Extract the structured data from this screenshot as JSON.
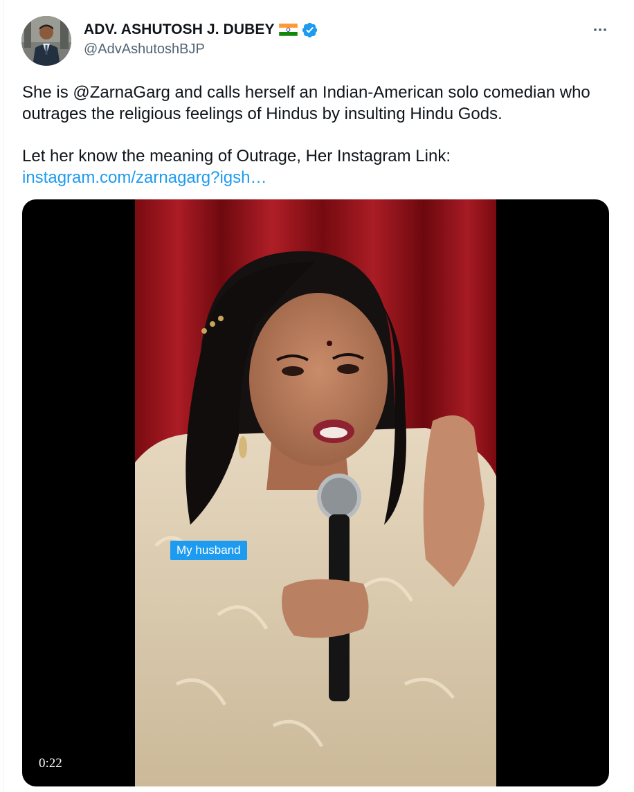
{
  "author": {
    "name": "ADV. ASHUTOSH J. DUBEY",
    "flag_icon": "india-flag-icon",
    "verified_icon": "verified-badge-icon",
    "handle": "@AdvAshutoshBJP"
  },
  "actions": {
    "more_icon": "more-dots-icon"
  },
  "tweet": {
    "paragraph1": "She is @ZarnaGarg and calls herself an Indian-American solo comedian who outrages the religious feelings of Hindus by insulting Hindu Gods.",
    "paragraph2": "Let her know the meaning of Outrage, Her Instagram Link:",
    "link": "instagram.com/zarnagarg?igsh…"
  },
  "video": {
    "caption": "My husband",
    "duration": "0:22"
  },
  "colors": {
    "accent": "#1d9bf0",
    "text": "#0f1419",
    "secondary": "#536471"
  }
}
